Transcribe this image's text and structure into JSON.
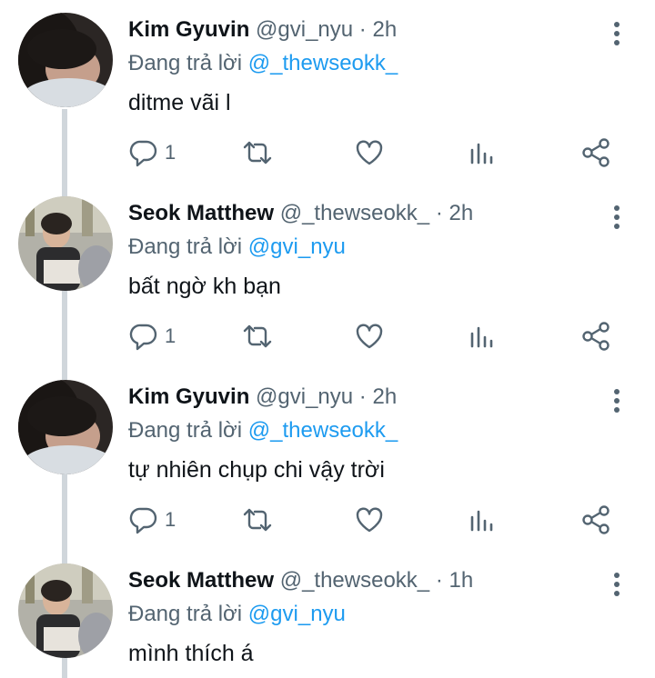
{
  "reply_prefix": "Đang trả lời",
  "dot": "·",
  "icons": [
    "reply-icon",
    "retweet-icon",
    "like-icon",
    "analytics-icon",
    "share-icon",
    "more-icon"
  ],
  "colors": {
    "text": "#0f1419",
    "secondary": "#536471",
    "link": "#1d9bf0",
    "thread_line": "#d0d6db"
  },
  "tweets": [
    {
      "name": "Kim Gyuvin",
      "handle": "@gvi_nyu",
      "time": "2h",
      "reply_to": "@_thewseokk_",
      "text": "ditme vãi l",
      "reply_count": "1"
    },
    {
      "name": "Seok Matthew",
      "handle": "@_thewseokk_",
      "time": "2h",
      "reply_to": "@gvi_nyu",
      "text": "bất ngờ kh bạn",
      "reply_count": "1"
    },
    {
      "name": "Kim Gyuvin",
      "handle": "@gvi_nyu",
      "time": "2h",
      "reply_to": "@_thewseokk_",
      "text": "tự nhiên chụp chi vậy trời",
      "reply_count": "1"
    },
    {
      "name": "Seok Matthew",
      "handle": "@_thewseokk_",
      "time": "1h",
      "reply_to": "@gvi_nyu",
      "text": "mình thích á",
      "reply_count": ""
    }
  ]
}
